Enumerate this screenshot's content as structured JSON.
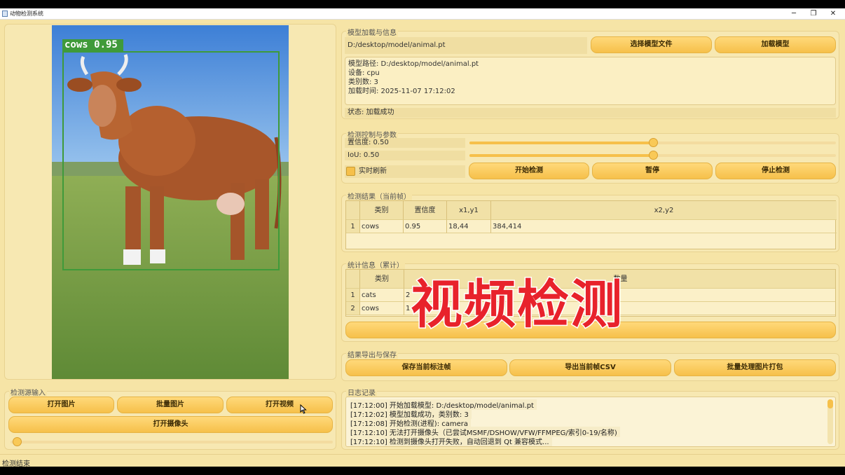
{
  "window": {
    "title": "动物检测系统",
    "minimize": "─",
    "restore": "❐",
    "close": "✕"
  },
  "preview": {
    "detection_label": "cows 0.95"
  },
  "source": {
    "title": "检测源输入",
    "buttons": [
      "打开图片",
      "批量图片",
      "打开视频"
    ],
    "camera_button": "打开摄像头",
    "progress": 0.02
  },
  "model": {
    "title": "模型加载与信息",
    "path": "D:/desktop/model/animal.pt",
    "choose_button": "选择模型文件",
    "load_button": "加载模型",
    "info": [
      "模型路径: D:/desktop/model/animal.pt",
      "设备: cpu",
      "类别数: 3",
      "加载时间: 2025-11-07 17:12:02"
    ],
    "status": "状态: 加载成功"
  },
  "control": {
    "title": "检测控制与参数",
    "confidence_label": "置信度: 0.50",
    "confidence": 0.5,
    "iou_label": "IoU: 0.50",
    "iou": 0.5,
    "realtime_label": "实时刷新",
    "start_button": "开始检测",
    "pause_button": "暂停",
    "stop_button": "停止检测"
  },
  "results": {
    "title": "检测结果（当前帧）",
    "headers": [
      "类别",
      "置信度",
      "x1,y1",
      "x2,y2"
    ],
    "rows": [
      {
        "index": "1",
        "cells": [
          "cows",
          "0.95",
          "18,44",
          "384,414"
        ]
      }
    ]
  },
  "stats": {
    "title": "统计信息（累计）",
    "headers": [
      "类别",
      "数量"
    ],
    "rows": [
      {
        "index": "1",
        "cells": [
          "cats",
          "2"
        ]
      },
      {
        "index": "2",
        "cells": [
          "cows",
          "1"
        ]
      }
    ]
  },
  "export": {
    "title": "结果导出与保存",
    "buttons": [
      "保存当前标注帧",
      "导出当前帧CSV",
      "批量处理图片打包"
    ]
  },
  "log": {
    "title": "日志记录",
    "lines": [
      "[17:12:00] 开始加载模型: D:/desktop/model/animal.pt",
      "[17:12:02] 模型加载成功，类别数: 3",
      "[17:12:08] 开始检测(进程): camera",
      "[17:12:10] 无法打开摄像头（已尝试MSMF/DSHOW/VFW/FFMPEG/索引0-19/名称)",
      "[17:12:10] 检测到摄像头打开失败，自动回退到 Qt 兼容模式..."
    ]
  },
  "statusbar": {
    "text": "检测结束"
  },
  "overlay": {
    "text": "视频检测"
  },
  "colors": {
    "accent": "#f6c04a",
    "background": "#f6e4a6",
    "bbox": "#3f9a3a",
    "overlay_text": "#e8222b"
  }
}
